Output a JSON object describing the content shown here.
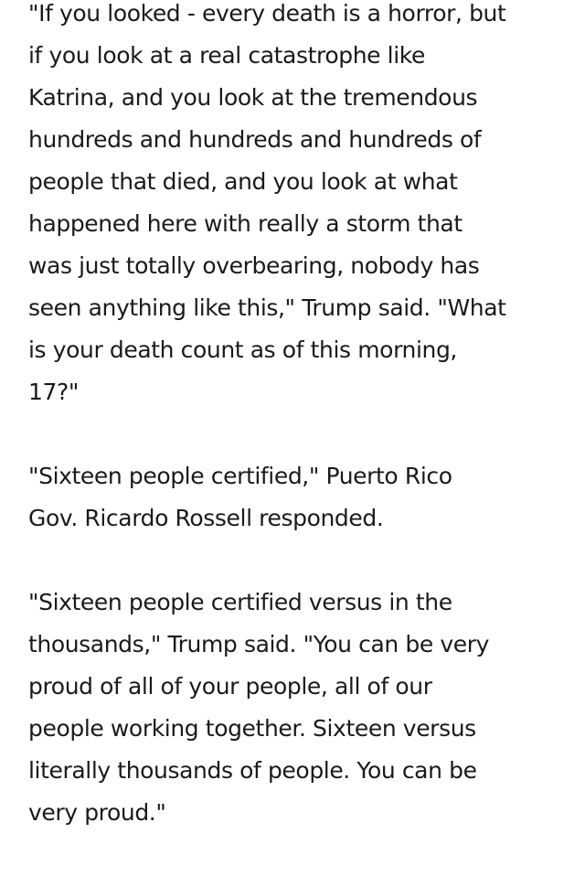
{
  "article": {
    "paragraphs": [
      {
        "lines": [
          "\"If you looked - every death is a horror, but",
          "if you look at a real catastrophe like",
          "Katrina, and you look at the tremendous",
          "hundreds and hundreds and hundreds of",
          "people that died, and you look at what",
          "happened here with really a storm that",
          "was just totally overbearing, nobody has",
          "seen anything like this,\" Trump said. \"What",
          "is your death count as of this morning,",
          "17?\""
        ]
      },
      {
        "lines": [
          "\"Sixteen people certified,\" Puerto Rico",
          "Gov. Ricardo Rossell responded."
        ]
      },
      {
        "lines": [
          "\"Sixteen people certified versus in the",
          "thousands,\" Trump said. \"You can be very",
          "proud of all of your people, all of our",
          "people working together. Sixteen versus",
          "literally thousands of people. You can be",
          "very proud.\""
        ]
      }
    ]
  }
}
